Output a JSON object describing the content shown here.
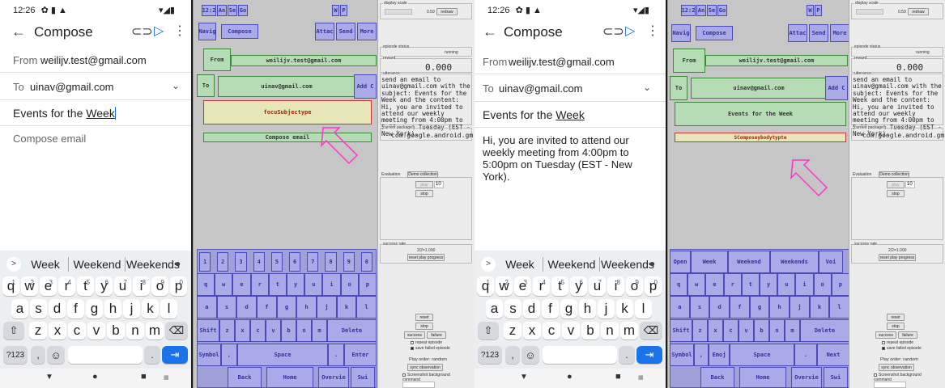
{
  "status": {
    "time": "12:26"
  },
  "toolbar": {
    "title": "Compose",
    "back_icon": "arrow-left-icon",
    "attach_icon": "paperclip-icon",
    "send_icon": "send-icon",
    "more_icon": "more-vert-icon"
  },
  "compose": {
    "from_label": "From",
    "from_value": "weilijv.test@gmail.com",
    "to_label": "To",
    "to_value": "uinav@gmail.com",
    "subject": "Events for the",
    "subject_cursor_word": "Week",
    "body_placeholder": "Compose email",
    "body_text": "Hi, you are invited to attend our weekly meeting from 4:00pm to 5:00pm on Tuesday (EST - New York)."
  },
  "keyboard": {
    "suggestions": [
      "Week",
      "Weekend",
      "Weekends"
    ],
    "row1": [
      "q",
      "w",
      "e",
      "r",
      "t",
      "y",
      "u",
      "i",
      "o",
      "p"
    ],
    "row1_nums": [
      "1",
      "2",
      "3",
      "4",
      "5",
      "6",
      "7",
      "8",
      "9",
      "0"
    ],
    "row2": [
      "a",
      "s",
      "d",
      "f",
      "g",
      "h",
      "j",
      "k",
      "l"
    ],
    "row3": [
      "z",
      "x",
      "c",
      "v",
      "b",
      "n",
      "m"
    ],
    "sym": "?123",
    "comma": ",",
    "period": "."
  },
  "emu": {
    "top": [
      "12:2",
      "An",
      "Se",
      "Go"
    ],
    "top_right": [
      "W",
      "P"
    ],
    "nav_row": [
      "Navig",
      "Compose",
      "Attac",
      "Send",
      "More"
    ],
    "from": "From",
    "from_val": "weilijv.test@gmail.com",
    "to": "To",
    "to_val": "uinav@gmail.com",
    "addc": "Add C",
    "focus_label": "focuSubjectype",
    "compose_email": "Compose email",
    "subject_box": "Events for the Week",
    "compose_box": "SComposeybodytypte",
    "nums": [
      "1",
      "2",
      "3",
      "4",
      "5",
      "6",
      "7",
      "8",
      "9",
      "0"
    ],
    "r1": [
      "q",
      "w",
      "e",
      "r",
      "t",
      "y",
      "u",
      "i",
      "o",
      "p"
    ],
    "r2": [
      "a",
      "s",
      "d",
      "f",
      "g",
      "h",
      "j",
      "k",
      "l"
    ],
    "r3": [
      "Shift",
      "z",
      "x",
      "c",
      "v",
      "b",
      "n",
      "m",
      "Delete"
    ],
    "r4": [
      "Symbol",
      ",",
      "Space",
      ".",
      "Enter"
    ],
    "r5": [
      "Back",
      "Home",
      "Overvie",
      "Swi"
    ],
    "sug": [
      "Open",
      "Week",
      "Weekend",
      "Weekends",
      "Voi"
    ],
    "r4b": [
      "Symbol",
      ",",
      "Emoj",
      "Space",
      ".",
      "Next"
    ]
  },
  "side": {
    "display_scale_label": "display scale",
    "scale_value": "0.59",
    "redraw": "redraw",
    "episode_status_label": "episode status",
    "episode_status": "running",
    "reward_label": "reward",
    "reward": "0.000",
    "utterance_label": "utterance",
    "utterance": "send an email to uinav@gmail.com with the subject: Events for the Week and the content: Hi, you are invited to attend our weekly meeting from 4:00pm to 5:00pm on Tuesday (EST - New York).",
    "package_label": "current package",
    "package": "com.google.android.gm",
    "tab_eval": "Evaluation",
    "tab_demo": "Demo collection",
    "play": "play",
    "count": "10",
    "stop": "stop",
    "success_rate_label": "success rate",
    "success_rate": "2/2=1.000",
    "reset_progress": "reset play progress",
    "reset": "reset",
    "stop2": "stop",
    "success": "success",
    "failure": "failure",
    "repeat": "repeat episode",
    "save_failed": "save failed episode",
    "play_order": "Play order: random",
    "sync": "sync observation",
    "screenshot_bg": "Screenshot background",
    "command_label": "command"
  },
  "colors": {
    "send_blue": "#1a73e8",
    "arrow_magenta": "#ff33cc",
    "emu_blue": "#aaaae8",
    "emu_green": "#b6dcb6"
  }
}
